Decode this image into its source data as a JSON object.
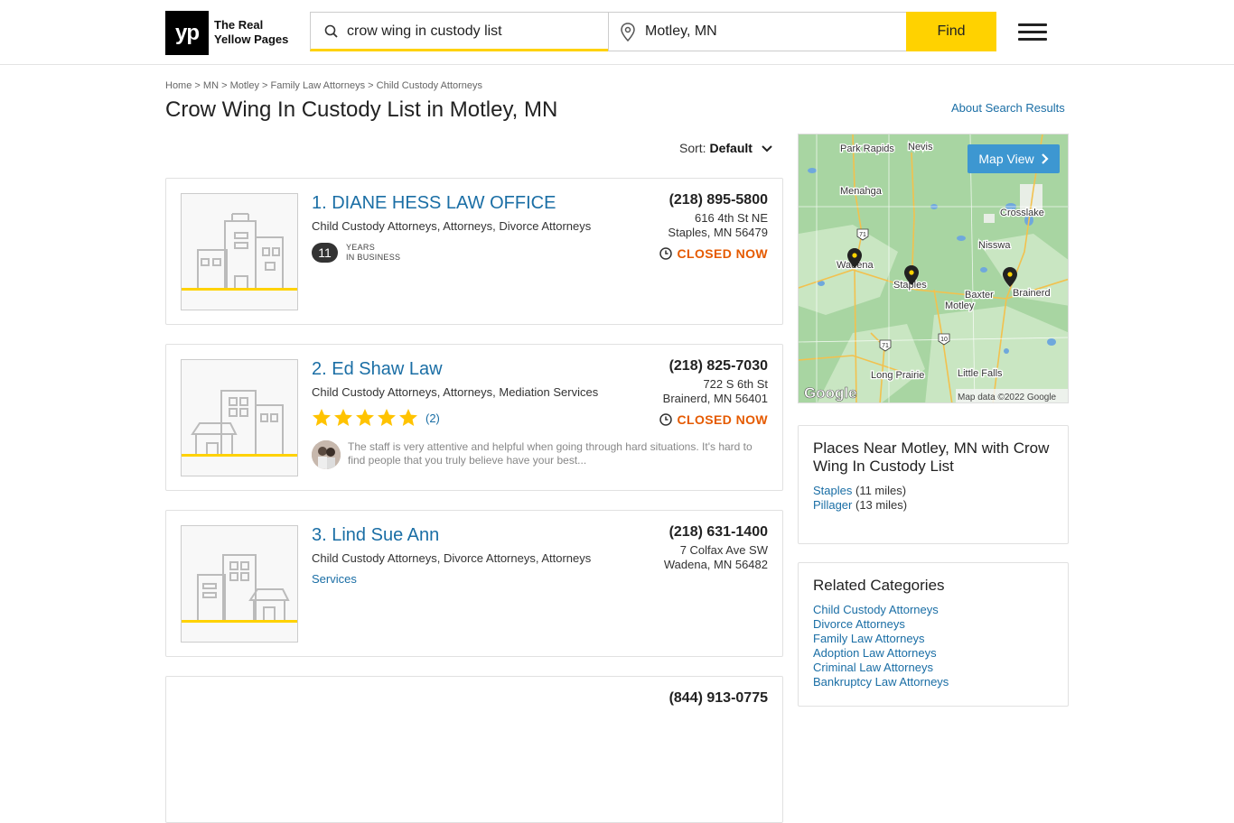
{
  "header": {
    "logo_mark": "yp",
    "logo_line1": "The Real",
    "logo_line2": "Yellow Pages",
    "search_value": "crow wing in custody list",
    "location_value": "Motley, MN",
    "find_label": "Find"
  },
  "breadcrumb": {
    "items": [
      "Home",
      "MN",
      "Motley",
      "Family Law Attorneys",
      "Child Custody Attorneys"
    ],
    "sep": ">"
  },
  "page": {
    "title": "Crow Wing In Custody List in Motley, MN",
    "about_link": "About Search Results",
    "sort_label": "Sort:",
    "sort_value": "Default"
  },
  "listings": [
    {
      "name": "1. DIANE HESS LAW OFFICE",
      "categories": "Child Custody Attorneys, Attorneys, Divorce Attorneys",
      "years": "11",
      "years_line1": "YEARS",
      "years_line2": "IN BUSINESS",
      "phone": "(218) 895-5800",
      "street": "616 4th St NE",
      "city": "Staples, MN 56479",
      "status": "CLOSED NOW"
    },
    {
      "name": "2. Ed Shaw Law",
      "categories": "Child Custody Attorneys, Attorneys, Mediation Services",
      "rating": 5,
      "review_count": "(2)",
      "review_text": "The staff is very attentive and helpful when going through hard situations. It's hard to find people that you truly believe have your best...",
      "phone": "(218) 825-7030",
      "street": "722 S 6th St",
      "city": "Brainerd, MN 56401",
      "status": "CLOSED NOW"
    },
    {
      "name": "3. Lind Sue Ann",
      "categories": "Child Custody Attorneys, Divorce Attorneys, Attorneys",
      "categories2": "Services",
      "phone": "(218) 631-1400",
      "street": "7 Colfax Ave SW",
      "city": "Wadena, MN 56482"
    },
    {
      "phone": "(844) 913-0775"
    }
  ],
  "map": {
    "map_view_label": "Map View",
    "attribution": "Map data ©2022 Google",
    "google": "Google",
    "places": [
      "Park Rapids",
      "Nevis",
      "Menahga",
      "Crosslake",
      "Nisswa",
      "Wadena",
      "Staples",
      "Baxter",
      "Brainerd",
      "Motley",
      "Long Prairie",
      "Little Falls"
    ],
    "roads": [
      "71",
      "71",
      "10"
    ]
  },
  "places_near": {
    "title": "Places Near Motley, MN with Crow Wing In Custody List",
    "items": [
      {
        "name": "Staples",
        "dist": "(11 miles)"
      },
      {
        "name": "Pillager",
        "dist": "(13 miles)"
      }
    ]
  },
  "related": {
    "title": "Related Categories",
    "items": [
      "Child Custody Attorneys",
      "Divorce Attorneys",
      "Family Law Attorneys",
      "Adoption Law Attorneys",
      "Criminal Law Attorneys",
      "Bankruptcy Law Attorneys"
    ]
  },
  "colors": {
    "brand_yellow": "#ffd200",
    "link_blue": "#1a6ea5",
    "closed_orange": "#e55a00",
    "map_button": "#3d97d1"
  }
}
